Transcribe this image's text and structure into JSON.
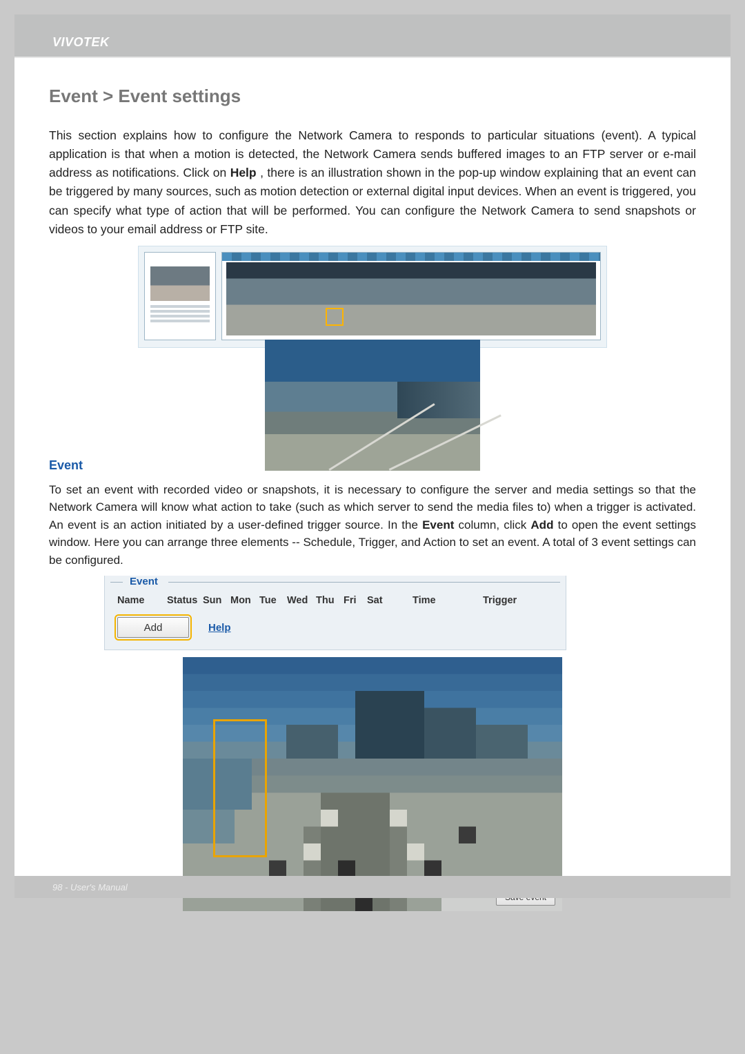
{
  "brand": "VIVOTEK",
  "page_title": "Event > Event settings",
  "intro_html_parts": {
    "before_help": "This section explains how to configure the Network Camera to responds to particular situations (event). A typical application is that when a motion is detected, the Network Camera sends buffered images to an FTP server or e-mail address as notifications. Click on ",
    "help_word": "Help",
    "after_help": ", there is an illustration shown in the pop-up window explaining that an event can be triggered by many sources, such as motion detection or external digital input devices. When an event is triggered, you can specify what type of action that will be performed. You can configure the Network Camera to send snapshots or videos to your email address or FTP site."
  },
  "event_subhead": "Event",
  "event_para_parts": {
    "p1": "To set an event with recorded video or snapshots, it is necessary to configure the server and media settings so that the Network Camera will know what action to take (such as which server to send the media files to) when a trigger is activated. An event is an action initiated by a user-defined trigger source. In the ",
    "b_event": "Event",
    "p2": "  column, click ",
    "b_add": "Add",
    "p3": " to open the event settings window. Here you can arrange three elements -- Schedule, Trigger, and Action to set an event. A total of 3 event settings can be configured."
  },
  "event_box": {
    "legend": "Event",
    "headers": [
      "Name",
      "Status",
      "Sun",
      "Mon",
      "Tue",
      "Wed",
      "Thu",
      "Fri",
      "Sat",
      "",
      "Time",
      "",
      "Trigger"
    ],
    "add_button": "Add",
    "help_link": "Help"
  },
  "pixel_image": {
    "save_button": "Save event"
  },
  "footer": {
    "page_no": "98",
    "label": "User's Manual"
  }
}
